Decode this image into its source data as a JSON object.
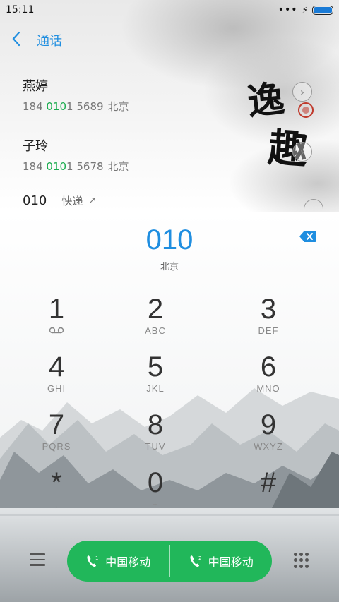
{
  "status_bar": {
    "time": "15:11",
    "dots": "•••",
    "battery_level": 1.0
  },
  "header": {
    "title": "通话"
  },
  "contacts": [
    {
      "name": "燕婷",
      "prefix": "184 ",
      "highlight": "010",
      "suffix": "1 5689",
      "city": "北京"
    },
    {
      "name": "子玲",
      "prefix": "184 ",
      "highlight": "010",
      "suffix": "1 5678",
      "city": "北京"
    }
  ],
  "quick_row": {
    "number": "010",
    "tag": "快递",
    "arrow": "↗"
  },
  "logo_text": {
    "char1": "逸",
    "char2": "趣"
  },
  "dial": {
    "number": "010",
    "location": "北京"
  },
  "keypad": [
    {
      "digit": "1",
      "letters": ""
    },
    {
      "digit": "2",
      "letters": "ABC"
    },
    {
      "digit": "3",
      "letters": "DEF"
    },
    {
      "digit": "4",
      "letters": "GHI"
    },
    {
      "digit": "5",
      "letters": "JKL"
    },
    {
      "digit": "6",
      "letters": "MNO"
    },
    {
      "digit": "7",
      "letters": "PQRS"
    },
    {
      "digit": "8",
      "letters": "TUV"
    },
    {
      "digit": "9",
      "letters": "WXYZ"
    },
    {
      "digit": "*",
      "letters": ","
    },
    {
      "digit": "0",
      "letters": "+"
    },
    {
      "digit": "#",
      "letters": ""
    }
  ],
  "call_buttons": [
    {
      "carrier": "中国移动",
      "sim": "1"
    },
    {
      "carrier": "中国移动",
      "sim": "2"
    }
  ],
  "colors": {
    "accent": "#1f8ee0",
    "call_green": "#21b75a",
    "match_green": "#1aab4e"
  }
}
